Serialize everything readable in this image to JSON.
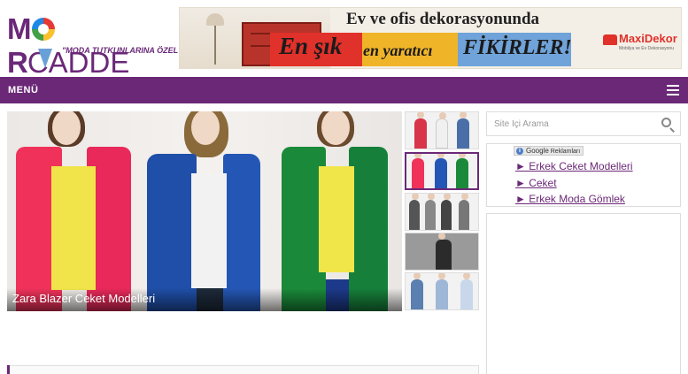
{
  "logo": {
    "text_mor": "MOR",
    "text_cadde": "CADDE",
    "tagline": "\"MODA TUTKUNLARINA ÖZEL\""
  },
  "banner": {
    "line1": "Ev ve ofis dekorasyonunda",
    "word1": "En şık",
    "word2": "en yaratıcı",
    "word3": "FİKİRLER!",
    "brand_name": "MaxiDekor",
    "brand_sub": "Mobilya ve Ev Dekorasyonu"
  },
  "menu": {
    "label": "MENÜ",
    "hamburger_icon": "hamburger-icon"
  },
  "slider": {
    "caption": "Zara Blazer Ceket Modelleri"
  },
  "thumbnails": [
    {
      "name": "thumb-1",
      "active": false
    },
    {
      "name": "thumb-2",
      "active": true
    },
    {
      "name": "thumb-3",
      "active": false
    },
    {
      "name": "thumb-4",
      "active": false
    },
    {
      "name": "thumb-5",
      "active": false
    }
  ],
  "search": {
    "placeholder": "Site İçi Arama",
    "icon": "search-icon"
  },
  "ads": {
    "badge_brand": "Google",
    "badge_label": "Reklamları",
    "links": [
      "► Erkek Ceket Modelleri",
      "► Ceket",
      "► Erkek Moda Gömlek"
    ]
  },
  "colors": {
    "brand_purple": "#6b2877",
    "link_purple": "#6b2877",
    "page_bg": "#ffffff"
  }
}
